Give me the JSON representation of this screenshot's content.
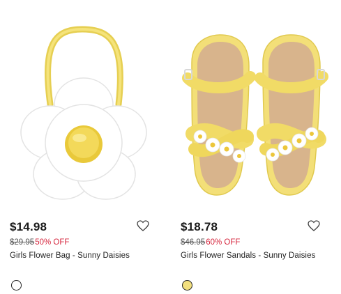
{
  "products": [
    {
      "image_alt": "Girls Flower Bag",
      "price": "$14.98",
      "was_price": "$29.95",
      "discount": "50% OFF",
      "name": "Girls Flower Bag - Sunny Daisies",
      "swatch_color": "#ffffff",
      "wishlist_icon": "heart-outline-icon"
    },
    {
      "image_alt": "Girls Flower Sandals",
      "price": "$18.78",
      "was_price": "$46.95",
      "discount": "60% OFF",
      "name": "Girls Flower Sandals - Sunny Daisies",
      "swatch_color": "#f2df7e",
      "wishlist_icon": "heart-outline-icon"
    }
  ],
  "colors": {
    "price": "#1a1a1a",
    "sale": "#d6273e",
    "was": "#555555"
  }
}
